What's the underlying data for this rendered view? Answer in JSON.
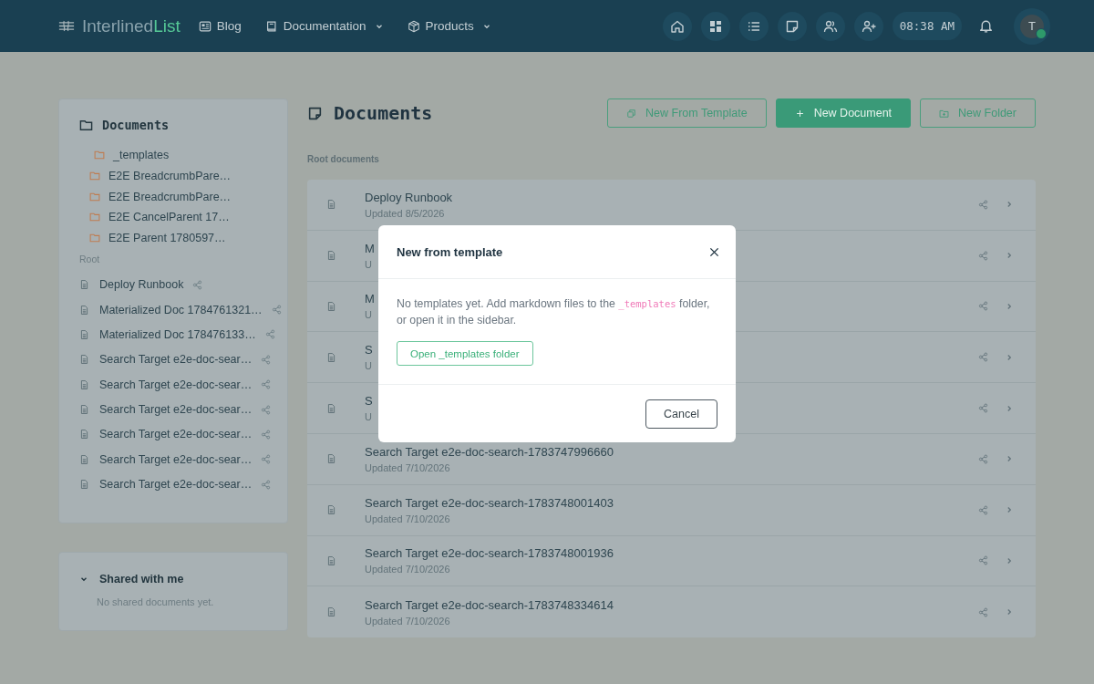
{
  "header": {
    "logo": {
      "dark_part": "Interlined",
      "accent_part": "List"
    },
    "links": [
      {
        "label": "Blog",
        "kind": "newspaper",
        "dropdown": false
      },
      {
        "label": "Documentation",
        "kind": "book",
        "dropdown": true
      },
      {
        "label": "Products",
        "kind": "box",
        "dropdown": true
      }
    ],
    "icon_buttons": [
      {
        "kind": "home"
      },
      {
        "kind": "dashboard"
      },
      {
        "kind": "list"
      },
      {
        "kind": "note"
      },
      {
        "kind": "users"
      },
      {
        "kind": "user-plus"
      }
    ],
    "clock": "08:38 AM",
    "avatar": {
      "initial": "T",
      "online": true
    }
  },
  "sidebar": {
    "title": "Documents",
    "folders": [
      "_templates",
      "E2E BreadcrumbPare…",
      "E2E BreadcrumbPare…",
      "E2E CancelParent 17…",
      "E2E Parent 1780597…"
    ],
    "section_label": "Root",
    "documents": [
      {
        "title": "Deploy Runbook",
        "shared": true
      },
      {
        "title": "Materialized Doc 1784761321…",
        "shared": true
      },
      {
        "title": "Materialized Doc 178476133…",
        "shared": true
      },
      {
        "title": "Search Target e2e-doc-sear…",
        "shared": true
      },
      {
        "title": "Search Target e2e-doc-sear…",
        "shared": true
      },
      {
        "title": "Search Target e2e-doc-sear…",
        "shared": true
      },
      {
        "title": "Search Target e2e-doc-sear…",
        "shared": true
      },
      {
        "title": "Search Target e2e-doc-sear…",
        "shared": true
      },
      {
        "title": "Search Target e2e-doc-sear…",
        "shared": true
      }
    ],
    "shared_panel": {
      "title": "Shared with me",
      "expanded": true,
      "empty_text": "No shared documents yet."
    }
  },
  "main": {
    "title": "Documents",
    "buttons": [
      {
        "label": "New From Template",
        "kind": "outline"
      },
      {
        "label": "New Document",
        "kind": "primary"
      },
      {
        "label": "New Folder",
        "kind": "outline"
      }
    ],
    "section_label": "Root documents",
    "rows": [
      {
        "title": "Deploy Runbook",
        "updated": "Updated 8/5/2026"
      },
      {
        "title": "M",
        "updated": "U"
      },
      {
        "title": "M",
        "updated": "U"
      },
      {
        "title": "S",
        "updated": "U"
      },
      {
        "title": "S",
        "updated": "U"
      },
      {
        "title": "Search Target e2e-doc-search-1783747996660",
        "updated": "Updated 7/10/2026"
      },
      {
        "title": "Search Target e2e-doc-search-1783748001403",
        "updated": "Updated 7/10/2026"
      },
      {
        "title": "Search Target e2e-doc-search-1783748001936",
        "updated": "Updated 7/10/2026"
      },
      {
        "title": "Search Target e2e-doc-search-1783748334614",
        "updated": "Updated 7/10/2026"
      }
    ]
  },
  "modal": {
    "title": "New from template",
    "text_before": "No templates yet. Add markdown files to the ",
    "code": "_templates",
    "text_after": " folder, or open it in the sidebar.",
    "open_button": "Open _templates folder",
    "cancel_button": "Cancel"
  }
}
